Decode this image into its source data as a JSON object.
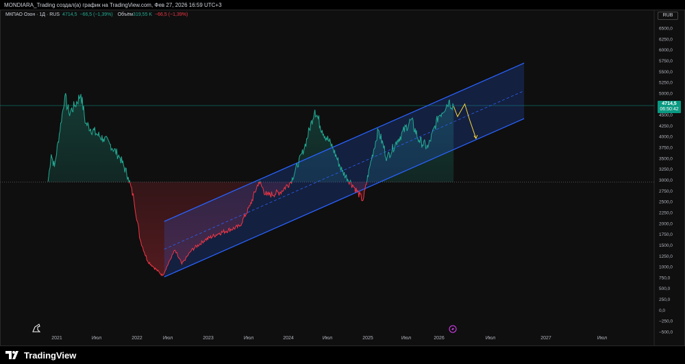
{
  "header": {
    "attribution": "MONDIARA_Trading создал(а) график на TradingView.com, Фев 27, 2026 16:59 UTC+3"
  },
  "legend": {
    "symbol": "МКПАО Озон · 1Д · RUS",
    "price": "4714,5",
    "change": "−66,5 (−1,39%)",
    "volume_label": "Объём",
    "volume": "319,55 K",
    "volume_change": "−66,5 (−1,39%)"
  },
  "currency_button": "RUB",
  "price_label": {
    "price": "4714,5",
    "countdown": "06:50:42"
  },
  "brand": "TradingView",
  "colors": {
    "up": "#22ab94",
    "down": "#f23645",
    "channel": "#2962ff",
    "projection": "#f5d63d"
  },
  "chart_data": {
    "type": "line",
    "baseline": 2950,
    "ylim": [
      -500,
      6500
    ],
    "y_ticks": [
      "6500,0",
      "6250,0",
      "6000,0",
      "5750,0",
      "5500,0",
      "5250,0",
      "5000,0",
      "4750,0",
      "4500,0",
      "4250,0",
      "4000,0",
      "3750,0",
      "3500,0",
      "3250,0",
      "3000,0",
      "2750,0",
      "2500,0",
      "2250,0",
      "2000,0",
      "1750,0",
      "1500,0",
      "1250,0",
      "1000,0",
      "750,0",
      "500,0",
      "250,0",
      "0,0",
      "−250,0",
      "−500,0"
    ],
    "x_ticks": [
      "2021",
      "Июл",
      "2022",
      "Июл",
      "2023",
      "Июл",
      "2024",
      "Июл",
      "2025",
      "Июл",
      "2026",
      "Июл",
      "2027",
      "Июл"
    ],
    "series": [
      {
        "name": "OZON close",
        "points": [
          [
            2020.89,
            2960
          ],
          [
            2020.93,
            3590
          ],
          [
            2020.97,
            3300
          ],
          [
            2021.1,
            4935
          ],
          [
            2021.15,
            4540
          ],
          [
            2021.22,
            4700
          ],
          [
            2021.3,
            4980
          ],
          [
            2021.36,
            4300
          ],
          [
            2021.49,
            4070
          ],
          [
            2021.58,
            3950
          ],
          [
            2021.66,
            3830
          ],
          [
            2021.79,
            3510
          ],
          [
            2021.89,
            3070
          ],
          [
            2021.96,
            2565
          ],
          [
            2022.04,
            1620
          ],
          [
            2022.13,
            1140
          ],
          [
            2022.21,
            985
          ],
          [
            2022.32,
            795
          ],
          [
            2022.47,
            1380
          ],
          [
            2022.56,
            1060
          ],
          [
            2022.68,
            1380
          ],
          [
            2022.85,
            1620
          ],
          [
            2023.03,
            1775
          ],
          [
            2023.28,
            1930
          ],
          [
            2023.41,
            2405
          ],
          [
            2023.52,
            2960
          ],
          [
            2023.62,
            2640
          ],
          [
            2023.79,
            2720
          ],
          [
            2023.92,
            2960
          ],
          [
            2024.09,
            3750
          ],
          [
            2024.22,
            4620
          ],
          [
            2024.31,
            4150
          ],
          [
            2024.44,
            3750
          ],
          [
            2024.56,
            3200
          ],
          [
            2024.69,
            2885
          ],
          [
            2024.82,
            2530
          ],
          [
            2024.91,
            3355
          ],
          [
            2025.01,
            4150
          ],
          [
            2025.12,
            3510
          ],
          [
            2025.25,
            3910
          ],
          [
            2025.42,
            4385
          ],
          [
            2025.52,
            3910
          ],
          [
            2025.63,
            3750
          ],
          [
            2025.76,
            4460
          ],
          [
            2025.89,
            4810
          ],
          [
            2025.95,
            4714.5
          ]
        ]
      }
    ],
    "channel": {
      "upper": [
        [
          2022.34,
          2044
        ],
        [
          2026.83,
          5694
        ]
      ],
      "lower": [
        [
          2022.34,
          764
        ],
        [
          2026.83,
          4414
        ]
      ]
    },
    "projection": [
      [
        2025.95,
        4700
      ],
      [
        2026.0,
        4461
      ],
      [
        2026.09,
        4750
      ],
      [
        2026.15,
        4385
      ],
      [
        2026.23,
        3955
      ]
    ]
  }
}
